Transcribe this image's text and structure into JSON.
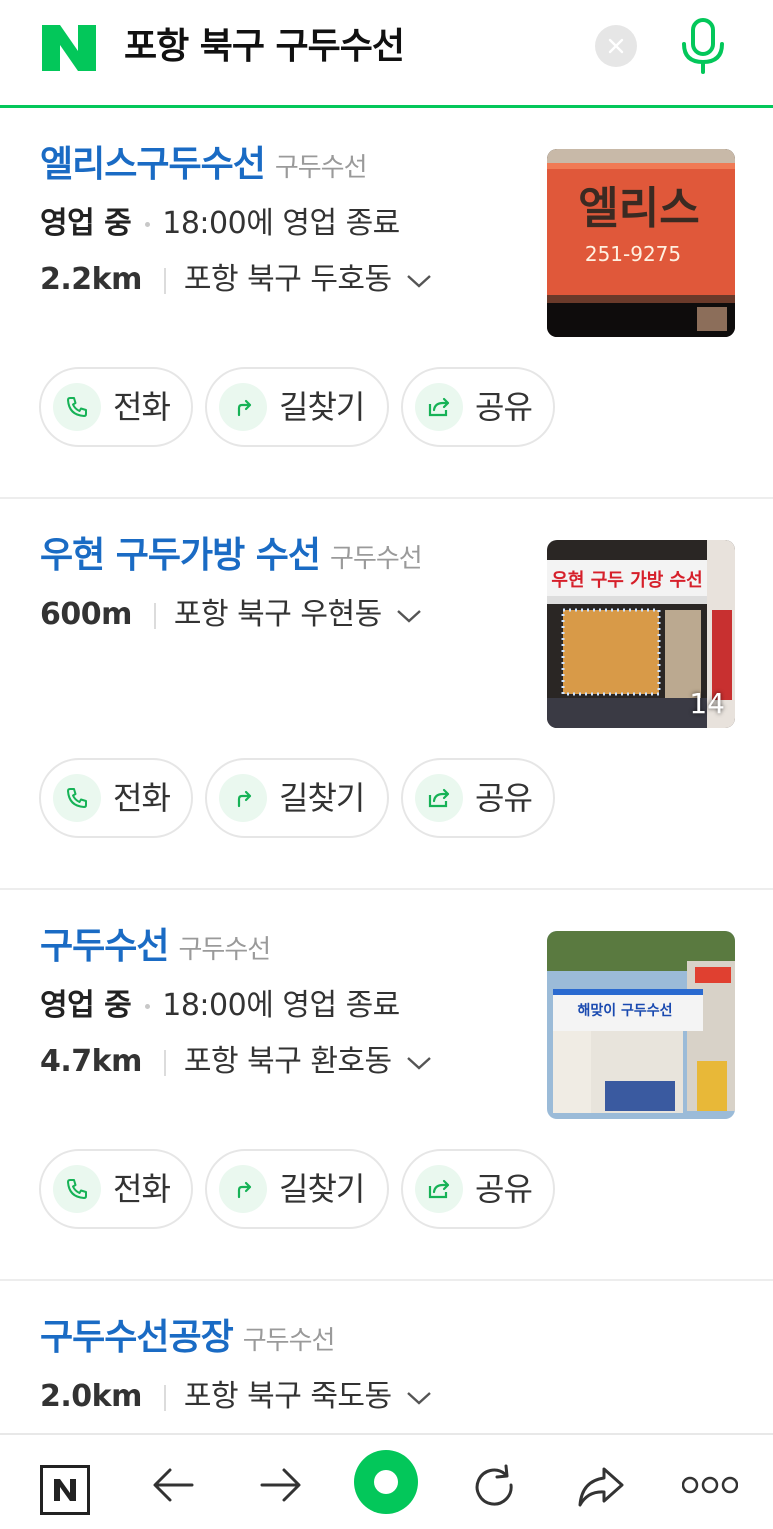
{
  "search": {
    "query": "포항 북구 구두수선",
    "logo_letter": "N",
    "brand_color": "#03c75a"
  },
  "actions": {
    "call": "전화",
    "directions": "길찾기",
    "share": "공유"
  },
  "places": [
    {
      "name": "엘리스구두수선",
      "category": "구두수선",
      "status": "영업 중",
      "hours": "18:00에 영업 종료",
      "distance": "2.2km",
      "address": "포항 북구 두호동",
      "photo_sign": "엘리스",
      "photo_phone": "251-9275"
    },
    {
      "name": "우현 구두가방 수선",
      "category": "구두수선",
      "distance": "600m",
      "address": "포항 북구 우현동",
      "photo_sign": "우현 구두 가방 수선",
      "photo_count": "14"
    },
    {
      "name": "구두수선",
      "category": "구두수선",
      "status": "영업 중",
      "hours": "18:00에 영업 종료",
      "distance": "4.7km",
      "address": "포항 북구 환호동",
      "photo_sign": "해맞이 구두수선"
    },
    {
      "name": "구두수선공장",
      "category": "구두수선",
      "distance": "2.0km",
      "address": "포항 북구 죽도동"
    }
  ],
  "icons": {
    "clear": "close-icon",
    "mic": "microphone-icon",
    "call": "phone-icon",
    "directions": "directions-arrow-icon",
    "share": "share-icon",
    "back": "arrow-left-icon",
    "forward": "arrow-right-icon",
    "reload": "reload-icon",
    "share_page": "share-arrow-icon",
    "more": "more-dots-icon"
  }
}
